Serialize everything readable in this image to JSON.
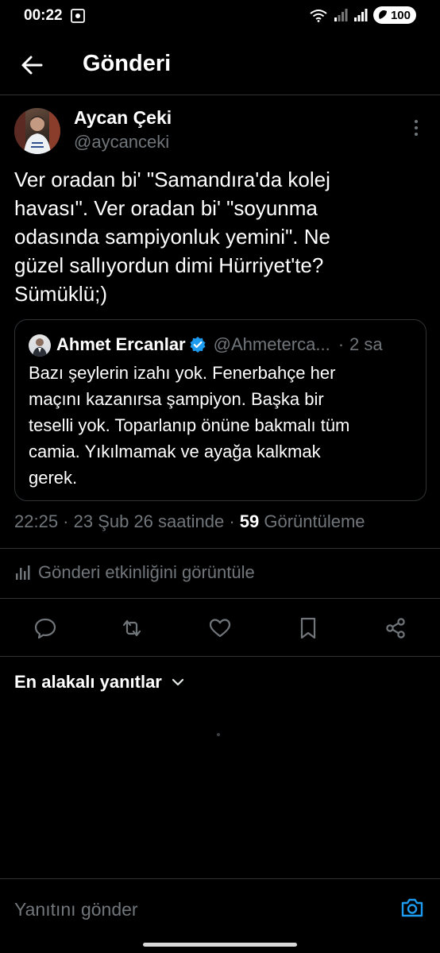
{
  "status_bar": {
    "time": "00:22",
    "battery": "100",
    "icons": [
      "screen-record-icon",
      "wifi-icon",
      "signal-icon",
      "signal-icon",
      "battery-saver-icon"
    ]
  },
  "header": {
    "title": "Gönderi",
    "back_icon": "arrow-left-icon"
  },
  "tweet": {
    "author_name": "Aycan Çeki",
    "author_handle": "@aycanceki",
    "text": "Ver oradan bi' \"Samandıra'da kolej\nhavası\". Ver oradan bi' \"soyunma\nodasında sampiyonluk yemini\". Ne\ngüzel sallıyordun dimi Hürriyet'te?\nSümüklü;)",
    "quote": {
      "author_name": "Ahmet Ercanlar",
      "author_handle": "@Ahmeterca...",
      "separator": "·",
      "time": "2 sa",
      "text": "Bazı şeylerin izahı yok. Fenerbahçe her\nmaçını kazanırsa şampiyon. Başka bir\nteselli yok. Toparlanıp önüne bakmalı tüm\ncamia. Yıkılmamak ve ayağa kalkmak\ngerek."
    },
    "meta_time": "22:25 · 23 Şub 26 saatinde · ",
    "views_count": "59",
    "views_label": " Görüntüleme",
    "activity_label": "Gönderi etkinliğini görüntüle"
  },
  "actions": [
    "reply-icon",
    "retweet-icon",
    "like-icon",
    "bookmark-icon",
    "share-icon"
  ],
  "replies": {
    "sort_label": "En alakalı yanıtlar"
  },
  "reply_bar": {
    "placeholder": "Yanıtını gönder"
  },
  "colors": {
    "background": "#000000",
    "text": "#e7e9ea",
    "muted": "#71767b",
    "accent": "#1d9bf0",
    "divider": "#2f3336"
  }
}
